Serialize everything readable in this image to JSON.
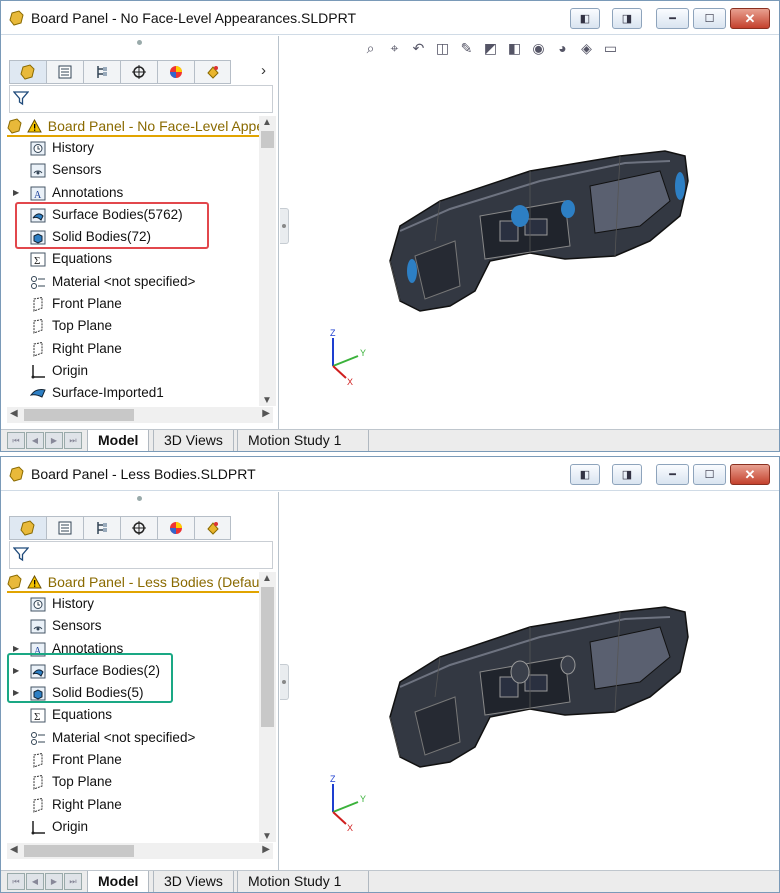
{
  "windows": [
    {
      "title": "Board Panel - No Face-Level Appearances.SLDPRT",
      "root_label": "Board Panel - No Face-Level Appearances",
      "tree": [
        {
          "label": "History",
          "icon": "history-icon",
          "expand": false
        },
        {
          "label": "Sensors",
          "icon": "sensors-icon",
          "expand": false
        },
        {
          "label": "Annotations",
          "icon": "annotations-icon",
          "expand": true
        },
        {
          "label": "Surface Bodies(5762)",
          "icon": "surface-bodies-icon",
          "expand": false
        },
        {
          "label": "Solid Bodies(72)",
          "icon": "solid-bodies-icon",
          "expand": false
        },
        {
          "label": "Equations",
          "icon": "equations-icon",
          "expand": false
        },
        {
          "label": "Material <not specified>",
          "icon": "material-icon",
          "expand": false
        },
        {
          "label": "Front Plane",
          "icon": "plane-icon",
          "expand": false
        },
        {
          "label": "Top Plane",
          "icon": "plane-icon",
          "expand": false
        },
        {
          "label": "Right Plane",
          "icon": "plane-icon",
          "expand": false
        },
        {
          "label": "Origin",
          "icon": "origin-icon",
          "expand": false
        },
        {
          "label": "Surface-Imported1",
          "icon": "surface-imported-icon",
          "expand": false
        }
      ],
      "highlight_color": "#e2474c",
      "triad": {
        "z": "Z",
        "y": "Y",
        "x": "X"
      }
    },
    {
      "title": "Board Panel - Less Bodies.SLDPRT",
      "root_label": "Board Panel - Less Bodies  (Default",
      "tree": [
        {
          "label": "History",
          "icon": "history-icon",
          "expand": false
        },
        {
          "label": "Sensors",
          "icon": "sensors-icon",
          "expand": false
        },
        {
          "label": "Annotations",
          "icon": "annotations-icon",
          "expand": true
        },
        {
          "label": "Surface Bodies(2)",
          "icon": "surface-bodies-icon",
          "expand": true
        },
        {
          "label": "Solid Bodies(5)",
          "icon": "solid-bodies-icon",
          "expand": true
        },
        {
          "label": "Equations",
          "icon": "equations-icon",
          "expand": false
        },
        {
          "label": "Material <not specified>",
          "icon": "material-icon",
          "expand": false
        },
        {
          "label": "Front Plane",
          "icon": "plane-icon",
          "expand": false
        },
        {
          "label": "Top Plane",
          "icon": "plane-icon",
          "expand": false
        },
        {
          "label": "Right Plane",
          "icon": "plane-icon",
          "expand": false
        },
        {
          "label": "Origin",
          "icon": "origin-icon",
          "expand": false
        }
      ],
      "highlight_color": "#1aa884",
      "triad": {
        "z": "Z",
        "y": "Y",
        "x": "X"
      }
    }
  ],
  "bottom_tabs": [
    "Model",
    "3D Views",
    "Motion Study 1"
  ],
  "accent": "#e1a400"
}
